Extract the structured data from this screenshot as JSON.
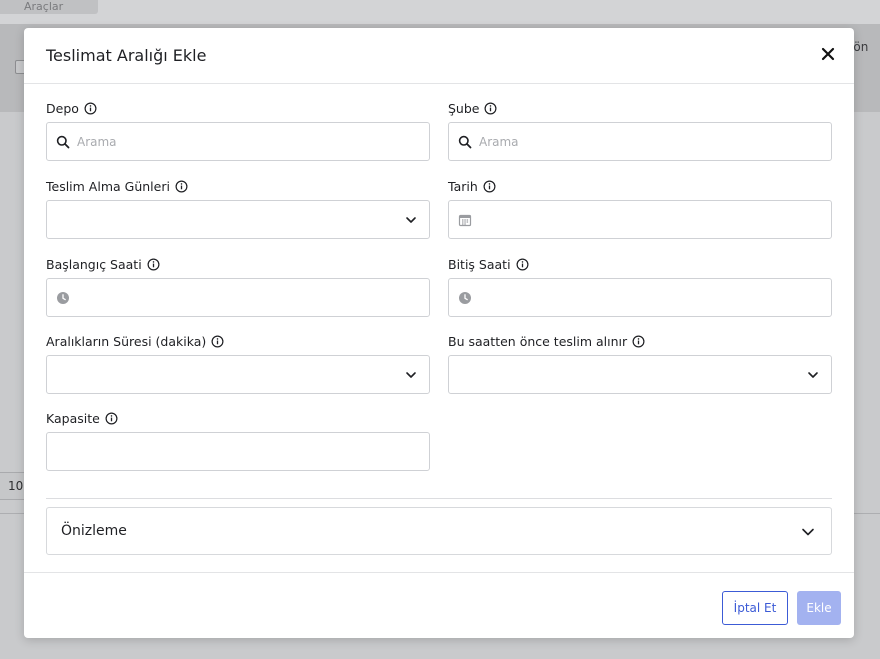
{
  "background": {
    "tools_label": "Araçlar",
    "column_partial": "n ön",
    "page_size": "10"
  },
  "modal": {
    "title": "Teslimat Aralığı Ekle",
    "fields": {
      "depo": {
        "label": "Depo",
        "placeholder": "Arama",
        "value": ""
      },
      "sube": {
        "label": "Şube",
        "placeholder": "Arama",
        "value": ""
      },
      "teslim_alma_gunleri": {
        "label": "Teslim Alma Günleri",
        "value": ""
      },
      "tarih": {
        "label": "Tarih",
        "value": ""
      },
      "baslangic_saati": {
        "label": "Başlangıç Saati",
        "value": ""
      },
      "bitis_saati": {
        "label": "Bitiş Saati",
        "value": ""
      },
      "araliklarin_suresi": {
        "label": "Aralıkların Süresi (dakika)",
        "value": ""
      },
      "bu_saatten_once": {
        "label": "Bu saatten önce teslim alınır",
        "value": ""
      },
      "kapasite": {
        "label": "Kapasite",
        "value": ""
      }
    },
    "preview_label": "Önizleme",
    "cancel_label": "İptal Et",
    "add_label": "Ekle"
  }
}
